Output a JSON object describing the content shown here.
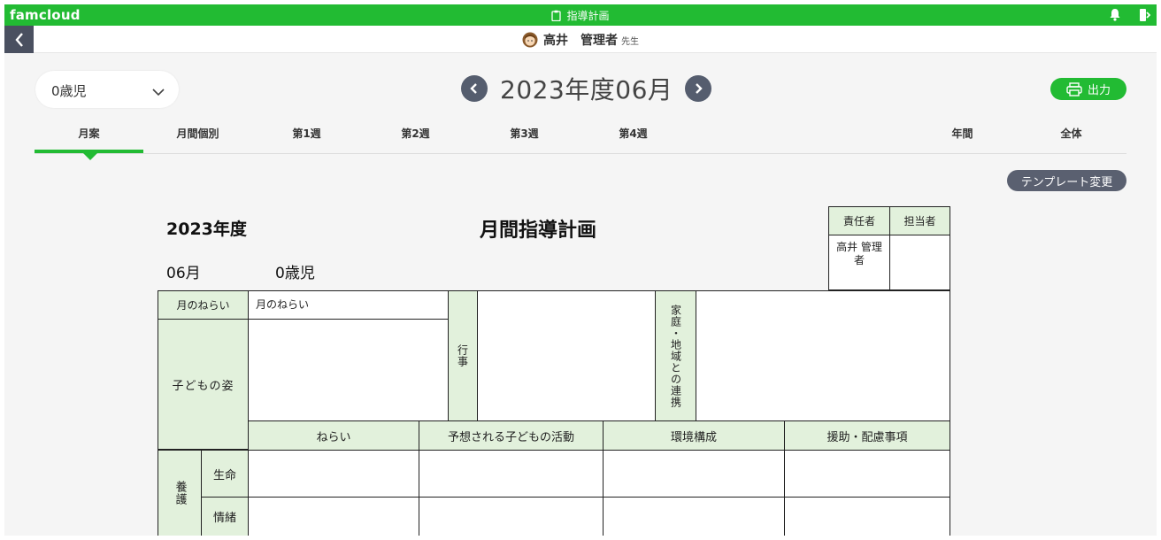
{
  "topbar": {
    "brand": "famcloud",
    "title": "指導計画"
  },
  "user": {
    "name": "高井　管理者",
    "suffix": "先生"
  },
  "age_select": {
    "value": "0歳児"
  },
  "month_nav": {
    "label": "2023年度06月"
  },
  "print_button": {
    "label": "出力"
  },
  "tabs": [
    {
      "label": "月案",
      "active": true
    },
    {
      "label": "月間個別"
    },
    {
      "label": "第1週"
    },
    {
      "label": "第2週"
    },
    {
      "label": "第3週"
    },
    {
      "label": "第4週"
    },
    {
      "label": "年間"
    },
    {
      "label": "全体"
    }
  ],
  "template_button": {
    "label": "テンプレート変更"
  },
  "document": {
    "year": "2023年度",
    "title": "月間指導計画",
    "month": "06月",
    "age": "0歳児",
    "sign": {
      "responsible_label": "責任者",
      "charge_label": "担当者",
      "responsible_value": "高井 管理者",
      "charge_value": ""
    },
    "monthly_aim_label": "月のねらい",
    "monthly_aim_value": "月のねらい",
    "child_state_label": "子どもの姿",
    "events_label": "行事",
    "family_label": "家庭・地域との連携",
    "columns": [
      "ねらい",
      "予想される子どもの活動",
      "環境構成",
      "援助・配慮事項"
    ],
    "care_label": "養護",
    "rows": [
      "生命",
      "情緒"
    ]
  },
  "colors": {
    "brand_green": "#22bb33",
    "header_cell": "#e2f1dc",
    "dark_button": "#5a6070"
  }
}
